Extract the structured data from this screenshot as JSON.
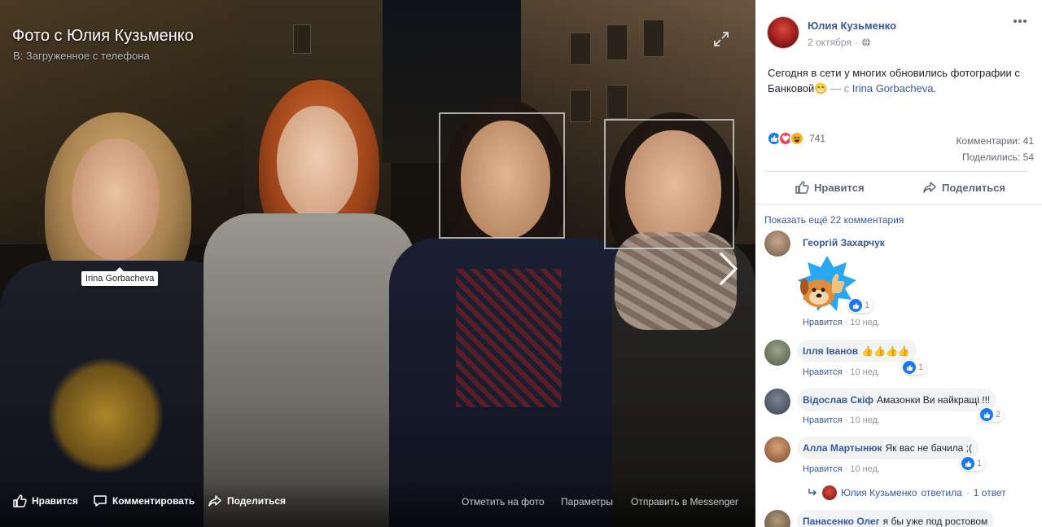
{
  "viewer": {
    "title": "Фото с Юлия Кузьменко",
    "album": "В: Загруженное с телефона",
    "tag_name": "Irina Gorbacheva",
    "actions": {
      "like": "Нравится",
      "comment": "Комментировать",
      "share": "Поделиться"
    },
    "links": {
      "tag": "Отметить на фото",
      "options": "Параметры",
      "messenger": "Отправить в Messenger"
    }
  },
  "post": {
    "author": "Юлия Кузьменко",
    "date": "2 октября",
    "text_main": "Сегодня в сети у многих обновились фотографии с Банковой",
    "text_emoji": "😁",
    "text_with": " — с ",
    "tagged_person": "Irina Gorbacheva",
    "text_end": ".",
    "reactions_count": "741",
    "comments_count": "Комментарии: 41",
    "shares_count": "Поделились: 54",
    "like_button": "Нравится",
    "share_button": "Поделиться",
    "more_comments": "Показать ещё 22 комментария"
  },
  "comments": [
    {
      "author": "Георгій Захарчук",
      "text": "",
      "like": "Нравится",
      "time": "10 нед.",
      "reactions": "1",
      "avatar_color": "#8a7a6a"
    },
    {
      "author": "Ілля Іванов",
      "text": "👍👍👍👍",
      "like": "Нравится",
      "time": "10 нед.",
      "reactions": "1",
      "avatar_color": "#6f7a66"
    },
    {
      "author": "Відослав Скіф",
      "text": "Амазонки Ви найкращі !!!",
      "like": "Нравится",
      "time": "10 нед.",
      "reactions": "2",
      "avatar_color": "#5a6470"
    },
    {
      "author": "Алла Мартынюк",
      "text": "Як вас не бачила ;(",
      "like": "Нравится",
      "time": "10 нед.",
      "reactions": "1",
      "avatar_color": "#a9714a"
    },
    {
      "author": "Панасенко Олег",
      "text": "я бы уже под ростовом",
      "like": "",
      "time": "",
      "reactions": "",
      "avatar_color": "#7a6650"
    }
  ],
  "reply": {
    "author": "Юлия Кузьменко",
    "verb": "ответила",
    "dot": "·",
    "count": "1 ответ"
  },
  "colors": {
    "link": "#385898",
    "like_blue": "#1877f2",
    "love_red": "#f33e58",
    "haha_yellow": "#f7b125"
  }
}
